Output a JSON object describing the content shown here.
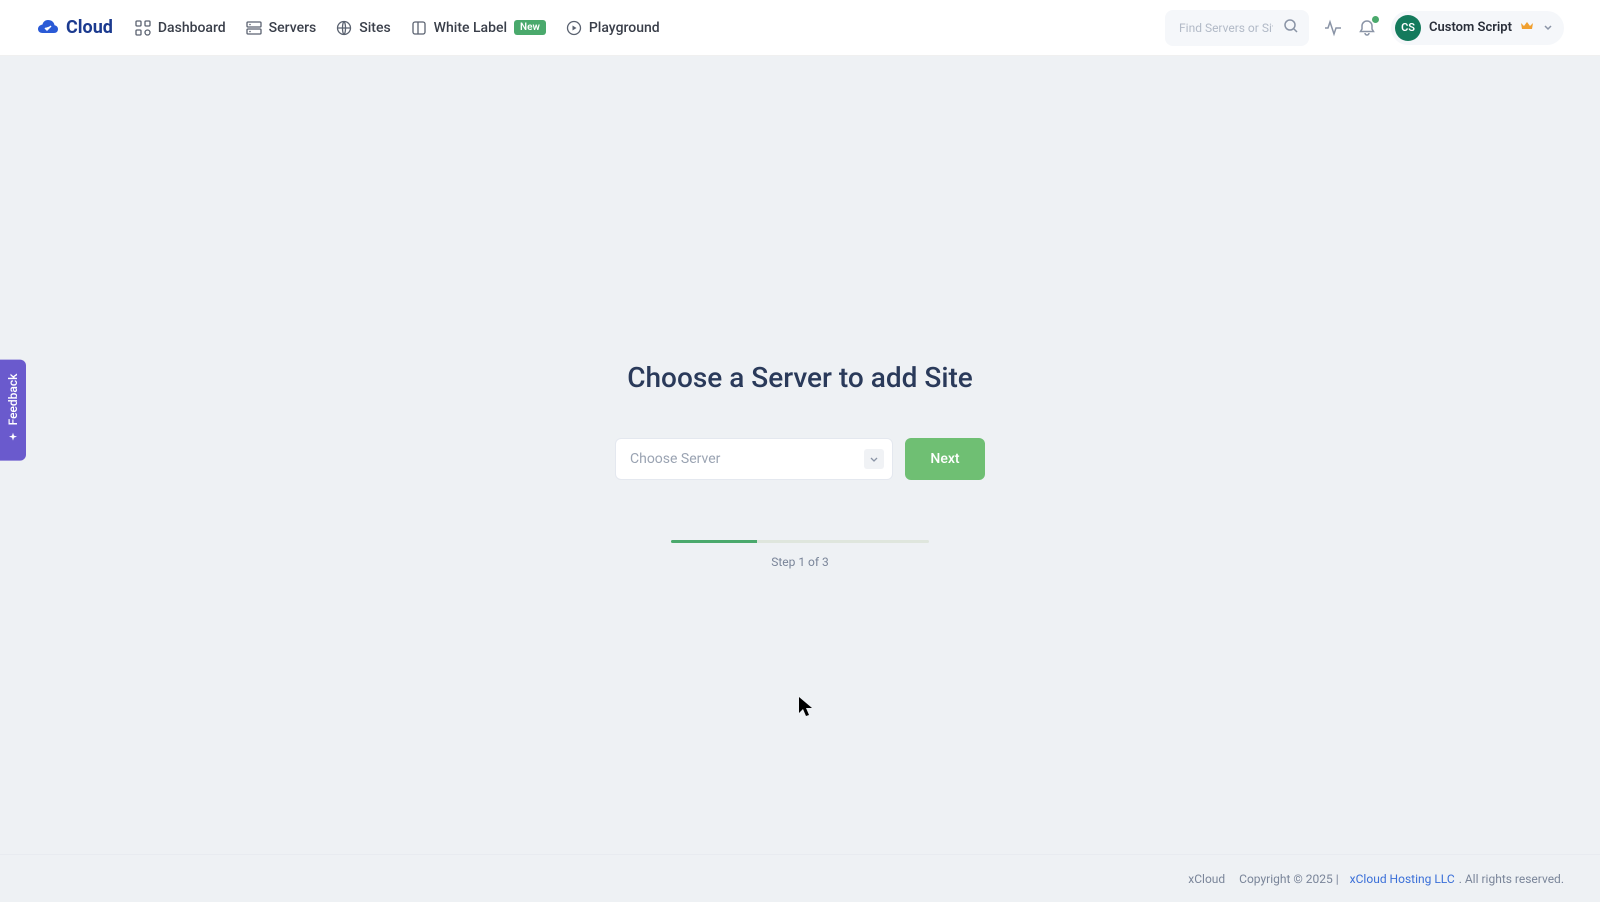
{
  "brand": "Cloud",
  "nav": {
    "dashboard": "Dashboard",
    "servers": "Servers",
    "sites": "Sites",
    "whitelabel": "White Label",
    "whitelabel_badge": "New",
    "playground": "Playground"
  },
  "search": {
    "placeholder": "Find Servers or Sites"
  },
  "user": {
    "initials": "CS",
    "name": "Custom Script"
  },
  "main": {
    "title": "Choose a Server to add Site",
    "select_placeholder": "Choose Server",
    "next": "Next",
    "step_label": "Step 1 of 3",
    "progress_percent": 33
  },
  "feedback": {
    "label": "Feedback"
  },
  "footer": {
    "product": "xCloud",
    "copyright": "Copyright © 2025 |",
    "link": "xCloud Hosting LLC",
    "tail": ". All rights reserved."
  }
}
